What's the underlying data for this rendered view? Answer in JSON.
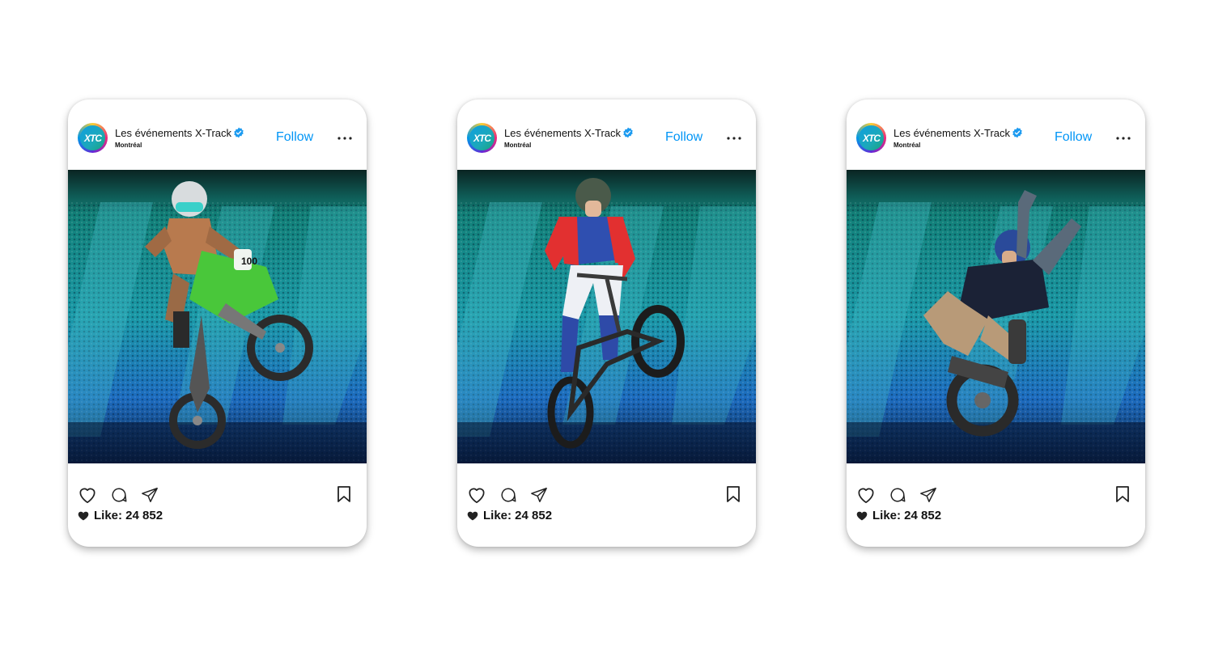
{
  "posts": [
    {
      "account_name": "Les événements X-Track",
      "location": "Montréal",
      "avatar_text": "XTC",
      "follow_label": "Follow",
      "likes_text": "Like: 24 852",
      "photo_subject": "motocross-rider",
      "bike_number": "100"
    },
    {
      "account_name": "Les événements X-Track",
      "location": "Montréal",
      "avatar_text": "XTC",
      "follow_label": "Follow",
      "likes_text": "Like: 24 852",
      "photo_subject": "bmx-rider"
    },
    {
      "account_name": "Les événements X-Track",
      "location": "Montréal",
      "avatar_text": "XTC",
      "follow_label": "Follow",
      "likes_text": "Like: 24 852",
      "photo_subject": "unicycle-rider"
    }
  ],
  "colors": {
    "follow": "#0095f6",
    "verified": "#1d9bf0",
    "text": "#111111",
    "photo_gradient_top": "#117a78",
    "photo_gradient_bottom": "#0c2a55"
  },
  "icons": {
    "like": "heart-outline-icon",
    "comment": "comment-bubble-icon",
    "share": "paper-plane-icon",
    "save": "bookmark-icon",
    "more": "more-dots-icon",
    "verified": "verified-badge-icon"
  }
}
